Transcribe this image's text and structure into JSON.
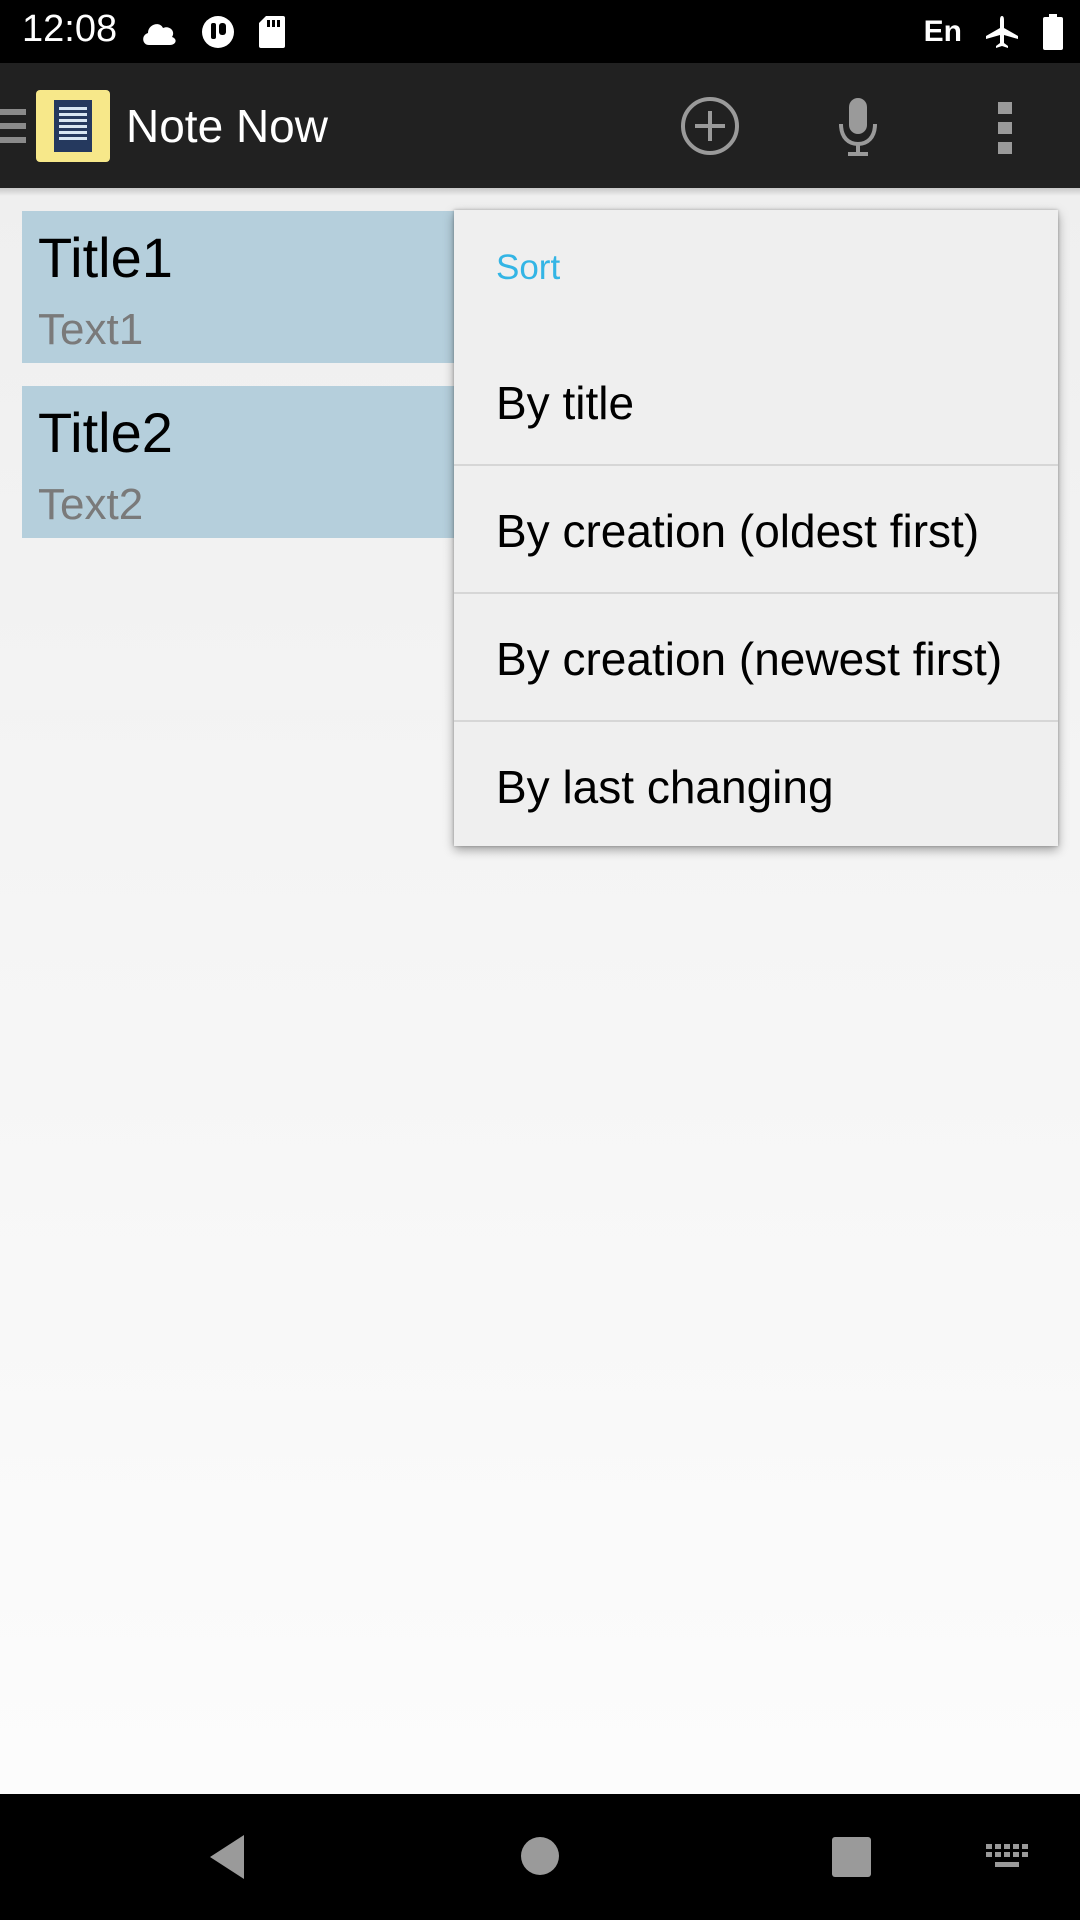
{
  "status_bar": {
    "time": "12:08",
    "language": "En",
    "left_icons": [
      "cloud-upload-icon",
      "onedrive-notification-icon",
      "sd-card-icon"
    ],
    "right_icons": [
      "airplane-mode-icon",
      "battery-icon"
    ]
  },
  "app_bar": {
    "title": "Note Now",
    "actions": [
      "add-note-icon",
      "microphone-icon",
      "overflow-menu-icon"
    ],
    "colors": {
      "background": "#212121",
      "logo": "#f7e88a"
    }
  },
  "notes": [
    {
      "title": "Title1",
      "text": "Text1"
    },
    {
      "title": "Title2",
      "text": "Text2"
    }
  ],
  "sort_menu": {
    "header": "Sort",
    "items": [
      "By title",
      "By creation (oldest first)",
      "By creation (newest first)",
      "By last changing"
    ],
    "accent_color": "#33b5e5"
  },
  "nav_bar": {
    "buttons": [
      "back-icon",
      "home-icon",
      "recents-icon",
      "keyboard-icon"
    ]
  }
}
